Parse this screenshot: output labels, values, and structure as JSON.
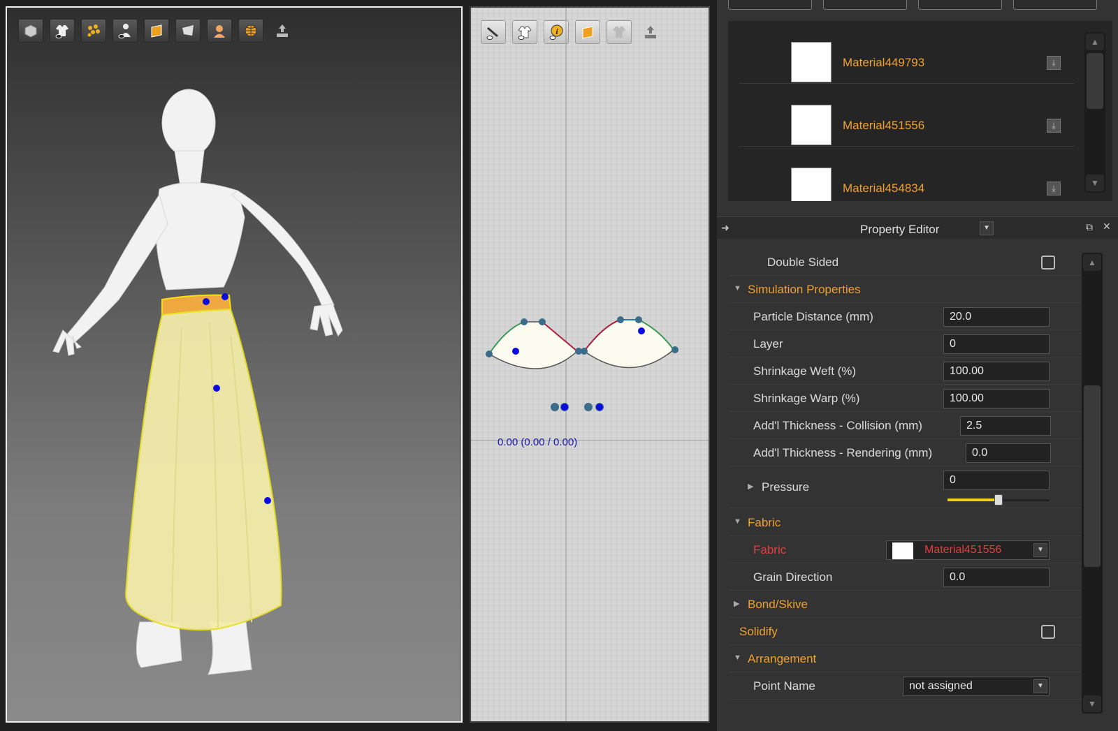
{
  "viewport3d": {
    "toolbar_icons": [
      "avatar-display-icon",
      "garment-display-icon",
      "points-display-icon",
      "avatar-visibility-icon",
      "texture-icon",
      "surface-icon",
      "skin-icon",
      "environment-icon",
      "export-icon"
    ]
  },
  "viewport2d": {
    "toolbar_icons": [
      "pencil-visibility-icon",
      "garment-visibility-icon",
      "info-icon",
      "texture-icon",
      "garment-grey-icon",
      "export-icon"
    ],
    "coordinate_readout": "0.00 (0.00 / 0.00)"
  },
  "materials": {
    "items": [
      {
        "name": "Material449793"
      },
      {
        "name": "Material451556"
      },
      {
        "name": "Material454834"
      }
    ]
  },
  "property_editor": {
    "title": "Property Editor",
    "double_sided_label": "Double Sided",
    "simulation_section": "Simulation Properties",
    "particle_distance_label": "Particle Distance (mm)",
    "particle_distance_value": "20.0",
    "layer_label": "Layer",
    "layer_value": "0",
    "shrinkage_weft_label": "Shrinkage Weft (%)",
    "shrinkage_weft_value": "100.00",
    "shrinkage_warp_label": "Shrinkage Warp (%)",
    "shrinkage_warp_value": "100.00",
    "thickness_collision_label": "Add'l Thickness - Collision (mm)",
    "thickness_collision_value": "2.5",
    "thickness_rendering_label": "Add'l Thickness - Rendering (mm)",
    "thickness_rendering_value": "0.0",
    "pressure_label": "Pressure",
    "pressure_value": "0",
    "pressure_slider_fraction": 0.5,
    "fabric_section": "Fabric",
    "fabric_label": "Fabric",
    "fabric_value": "Material451556",
    "grain_direction_label": "Grain Direction",
    "grain_direction_value": "0.0",
    "bond_skive_section": "Bond/Skive",
    "solidify_label": "Solidify",
    "arrangement_section": "Arrangement",
    "point_name_label": "Point Name",
    "point_name_value": "not assigned"
  },
  "colors": {
    "accent_orange": "#f0a030",
    "error_red": "#e04040",
    "skirt_yellow": "#f3ecaa"
  }
}
